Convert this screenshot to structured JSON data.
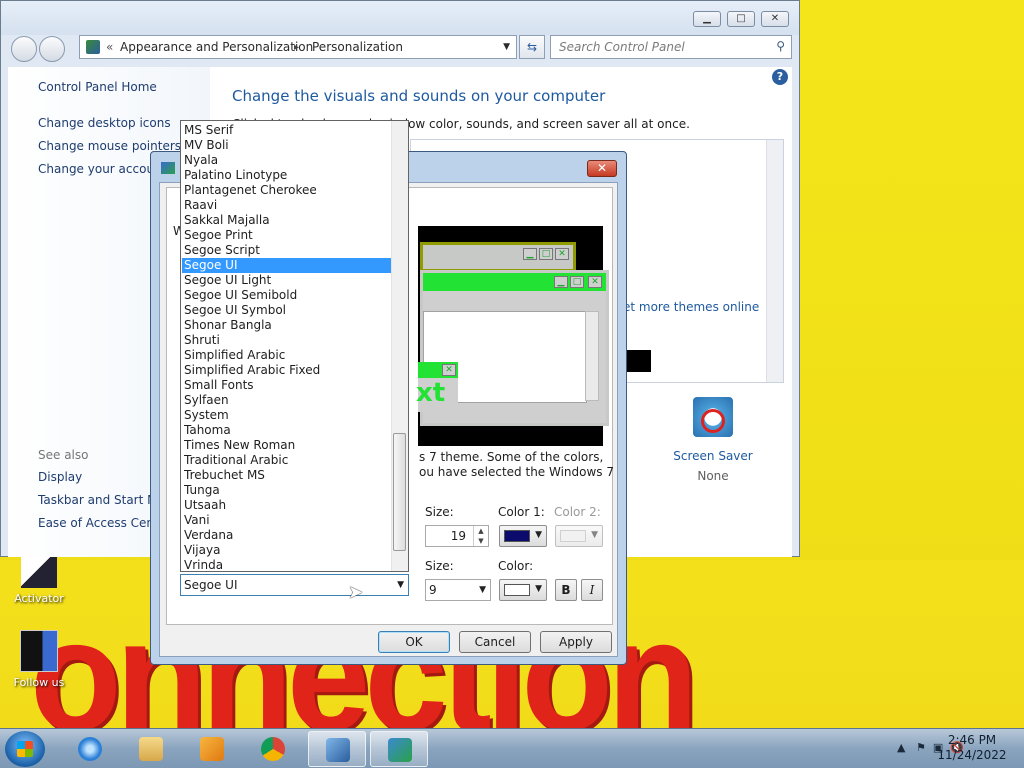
{
  "window": {
    "address": {
      "sep": "«",
      "part1": "Appearance and Personalization",
      "arrow": "▸",
      "part2": "Personalization"
    },
    "search_placeholder": "Search Control Panel",
    "sidebar_links": [
      "Control Panel Home",
      "Change desktop icons",
      "Change mouse pointers",
      "Change your account"
    ],
    "see_also_label": "See also",
    "see_also_links": [
      "Display",
      "Taskbar and Start Me",
      "Ease of Access Center"
    ],
    "heading": "Change the visuals and sounds on your computer",
    "description": "Click                    sktop background, window color, sounds, and screen saver all at once.",
    "more_themes": "et more themes online",
    "screen_saver_label": "Screen Saver",
    "screen_saver_value": "None",
    "minimize": "▁",
    "maximize": "□",
    "close": "✕"
  },
  "dialog": {
    "close": "✕",
    "partial_tab_text": "W",
    "preview_text_fragment": "xt",
    "desc_line1": "s 7 theme.  Some of the colors,",
    "desc_line2": "ou have selected the Windows 7",
    "size_label_1": "Size:",
    "size_value_1": "19",
    "color1_label": "Color 1:",
    "color2_label": "Color 2:",
    "size_label_2": "Size:",
    "size_value_2": "9",
    "color_label": "Color:",
    "bold_label": "B",
    "italic_label": "I",
    "ok_label": "OK",
    "cancel_label": "Cancel",
    "apply_label": "Apply",
    "font_value": "Segoe UI",
    "color1_swatch": "#0b0b6e",
    "color_swatch": "#ffffff"
  },
  "font_list": {
    "selected": "Segoe UI",
    "items": [
      "MS Serif",
      "MV Boli",
      "Nyala",
      "Palatino Linotype",
      "Plantagenet Cherokee",
      "Raavi",
      "Sakkal Majalla",
      "Segoe Print",
      "Segoe Script",
      "Segoe UI",
      "Segoe UI Light",
      "Segoe UI Semibold",
      "Segoe UI Symbol",
      "Shonar Bangla",
      "Shruti",
      "Simplified Arabic",
      "Simplified Arabic Fixed",
      "Small Fonts",
      "Sylfaen",
      "System",
      "Tahoma",
      "Times New Roman",
      "Traditional Arabic",
      "Trebuchet MS",
      "Tunga",
      "Utsaah",
      "Vani",
      "Verdana",
      "Vijaya",
      "Vrinda"
    ]
  },
  "desktop": {
    "icons": [
      "Activator",
      "Follow us"
    ],
    "banner_text": "onnection"
  },
  "taskbar": {
    "time": "2:46 PM",
    "date": "11/24/2022",
    "apps": [
      "internet-explorer",
      "file-explorer",
      "media-player",
      "chrome",
      "control-panel",
      "personalization"
    ]
  }
}
